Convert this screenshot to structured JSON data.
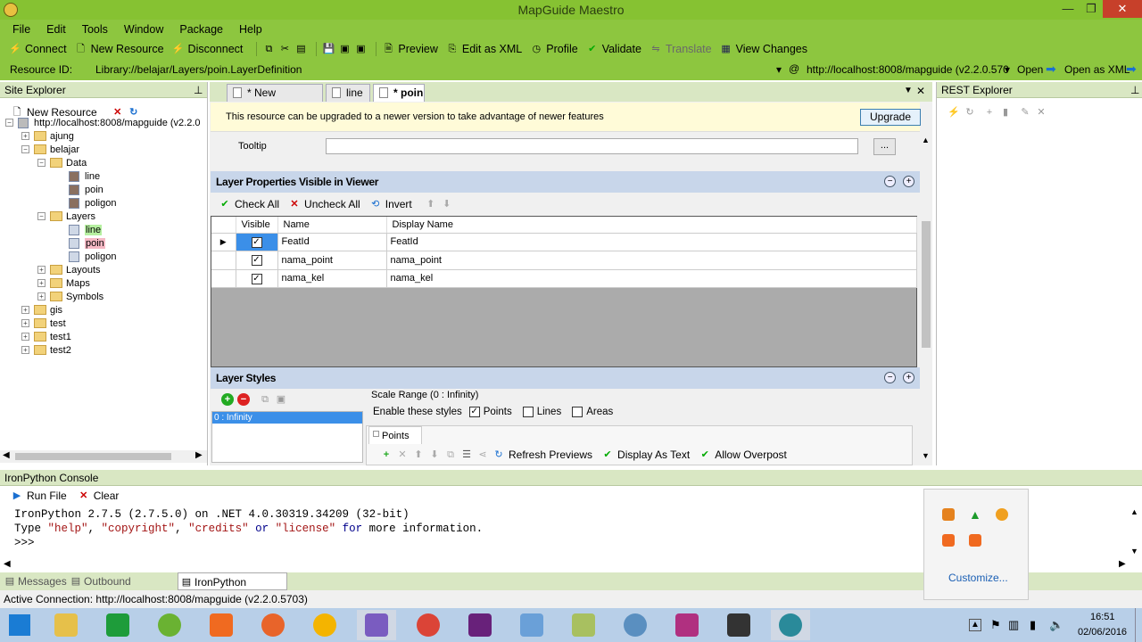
{
  "window": {
    "title": "MapGuide Maestro"
  },
  "menu": [
    "File",
    "Edit",
    "Tools",
    "Window",
    "Package",
    "Help"
  ],
  "toolbar": {
    "connect": "Connect",
    "new_resource": "New Resource",
    "disconnect": "Disconnect",
    "preview": "Preview",
    "edit_as_xml": "Edit as XML",
    "profile": "Profile",
    "validate": "Validate",
    "translate": "Translate",
    "view_changes": "View Changes"
  },
  "resource_bar": {
    "label": "Resource ID:",
    "value": "Library://belajar/Layers/poin.LayerDefinition",
    "server": "http://localhost:8008/mapguide (v2.2.0.570",
    "open": "Open",
    "open_as_xml": "Open as XML"
  },
  "site_explorer": {
    "title": "Site Explorer",
    "new_resource": "New Resource",
    "root": "http://localhost:8008/mapguide (v2.2.0",
    "items": {
      "ajung": "ajung",
      "belajar": "belajar",
      "data": "Data",
      "data_line": "line",
      "data_poin": "poin",
      "data_poligon": "poligon",
      "layers": "Layers",
      "layers_line": "line",
      "layers_poin": "poin",
      "layers_poligon": "poligon",
      "layouts": "Layouts",
      "maps": "Maps",
      "symbols": "Symbols",
      "gis": "gis",
      "test": "test",
      "test1": "test1",
      "test2": "test2"
    }
  },
  "doc_tabs": [
    "* New Resource",
    "line",
    "* poin"
  ],
  "upgrade": {
    "message": "This resource can be upgraded to a newer version to take advantage of newer features",
    "button": "Upgrade"
  },
  "tooltip": {
    "label": "Tooltip",
    "value": "",
    "browse": "..."
  },
  "layer_props": {
    "title": "Layer Properties Visible in Viewer",
    "check_all": "Check All",
    "uncheck_all": "Uncheck All",
    "invert": "Invert",
    "columns": [
      "Visible",
      "Name",
      "Display Name"
    ],
    "rows": [
      {
        "name": "FeatId",
        "display": "FeatId",
        "visible": "✓"
      },
      {
        "name": "nama_point",
        "display": "nama_point",
        "visible": "✓"
      },
      {
        "name": "nama_kel",
        "display": "nama_kel",
        "visible": "✓"
      }
    ]
  },
  "layer_styles": {
    "title": "Layer Styles",
    "scale_item": "0 : Infinity",
    "scale_range": "Scale Range (0 : Infinity)",
    "enable_label": "Enable these styles",
    "points": "Points",
    "lines": "Lines",
    "areas": "Areas",
    "tab_points": "Points",
    "refresh_previews": "Refresh Previews",
    "display_as_text": "Display As Text",
    "allow_overpost": "Allow Overpost"
  },
  "rest_explorer": {
    "title": "REST Explorer"
  },
  "console": {
    "title": "IronPython Console",
    "run_file": "Run File",
    "clear": "Clear",
    "line1": "IronPython 2.7.5 (2.7.5.0) on .NET 4.0.30319.34209 (32-bit)",
    "line2_a": "Type ",
    "line2_help": "\"help\"",
    "line2_c1": ", ",
    "line2_copyright": "\"copyright\"",
    "line2_c2": ", ",
    "line2_credits": "\"credits\"",
    "line2_or": " or ",
    "line2_license": "\"license\"",
    "line2_for": " for",
    "line2_end": " more information.",
    "prompt": ">>>"
  },
  "bottom_tabs": [
    "Messages",
    "Outbound Requests",
    "IronPython Console"
  ],
  "status": "Active Connection: http://localhost:8008/mapguide (v2.2.0.5703)",
  "tray": {
    "customize": "Customize...",
    "time": "16:51",
    "date": "02/06/2016"
  },
  "colors": {
    "accent": "#8dc63f",
    "selection": "#3b8fe8"
  }
}
